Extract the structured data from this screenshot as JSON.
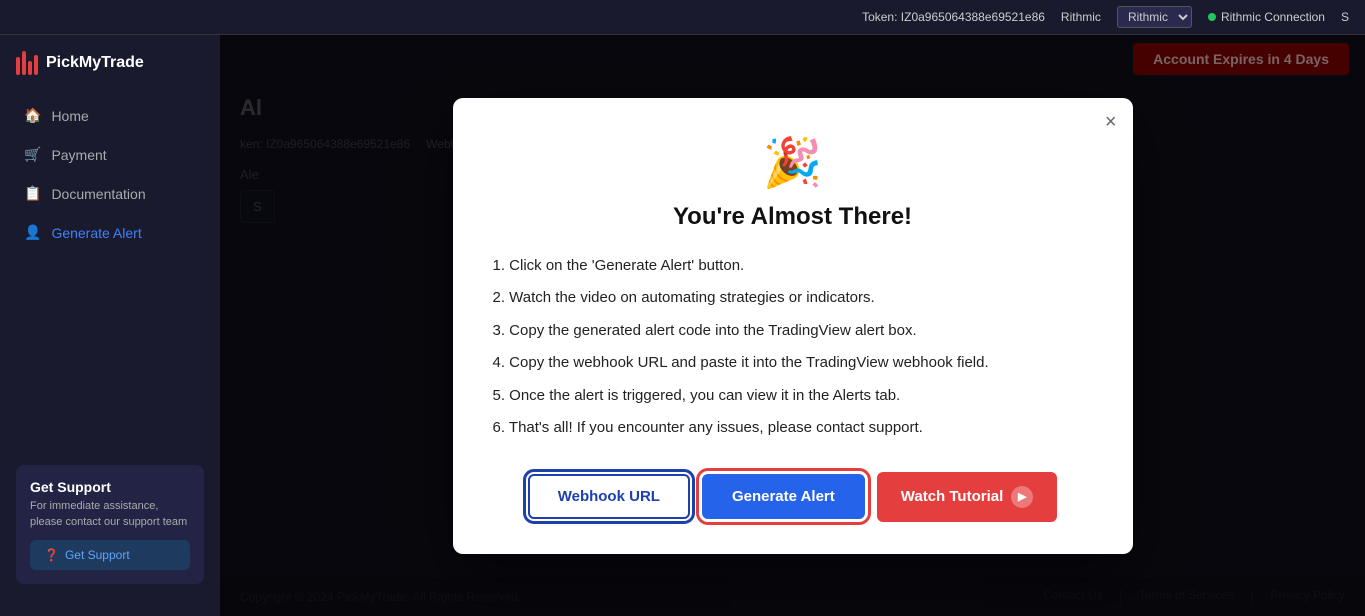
{
  "topbar": {
    "token_label": "Token:",
    "token_value": "IZ0a965064388e69521e86",
    "broker": "Rithmic",
    "connection_label": "Rithmic Connection",
    "connection_status": "S",
    "account_expires_btn": "Account Expires in 4 Days",
    "second_token_label": "ken: IZ0a965064388e69521e86",
    "webhook_label": "Webhook"
  },
  "sidebar": {
    "logo_text": "PickMyTrade",
    "nav_items": [
      {
        "id": "home",
        "label": "Home",
        "icon": "🏠"
      },
      {
        "id": "payment",
        "label": "Payment",
        "icon": "🛒"
      },
      {
        "id": "documentation",
        "label": "Documentation",
        "icon": "📋"
      },
      {
        "id": "generate-alert",
        "label": "Generate Alert",
        "icon": "👤",
        "active": true
      }
    ],
    "support": {
      "title": "Get Support",
      "description": "For immediate assistance, please contact our support team",
      "button_label": "Get Support"
    }
  },
  "page": {
    "title": "Al",
    "alert_label": "Ale",
    "select_placeholder": "S"
  },
  "modal": {
    "emoji": "🎉",
    "title": "You're Almost There!",
    "steps": [
      "1. Click on the 'Generate Alert' button.",
      "2. Watch the video on automating strategies or indicators.",
      "3. Copy the generated alert code into the TradingView alert box.",
      "4. Copy the webhook URL and paste it into the TradingView webhook field.",
      "5. Once the alert is triggered, you can view it in the Alerts tab.",
      "6. That's all! If you encounter any issues, please contact support."
    ],
    "close_label": "×",
    "btn_webhook": "Webhook URL",
    "btn_generate": "Generate Alert",
    "btn_watch": "Watch Tutorial"
  },
  "footer": {
    "copyright": "Copyright © 2024 PickMyTrade. All Rights Reserved.",
    "links": [
      "Contact Us",
      "Terms of Services",
      "Privacy Policy"
    ]
  }
}
